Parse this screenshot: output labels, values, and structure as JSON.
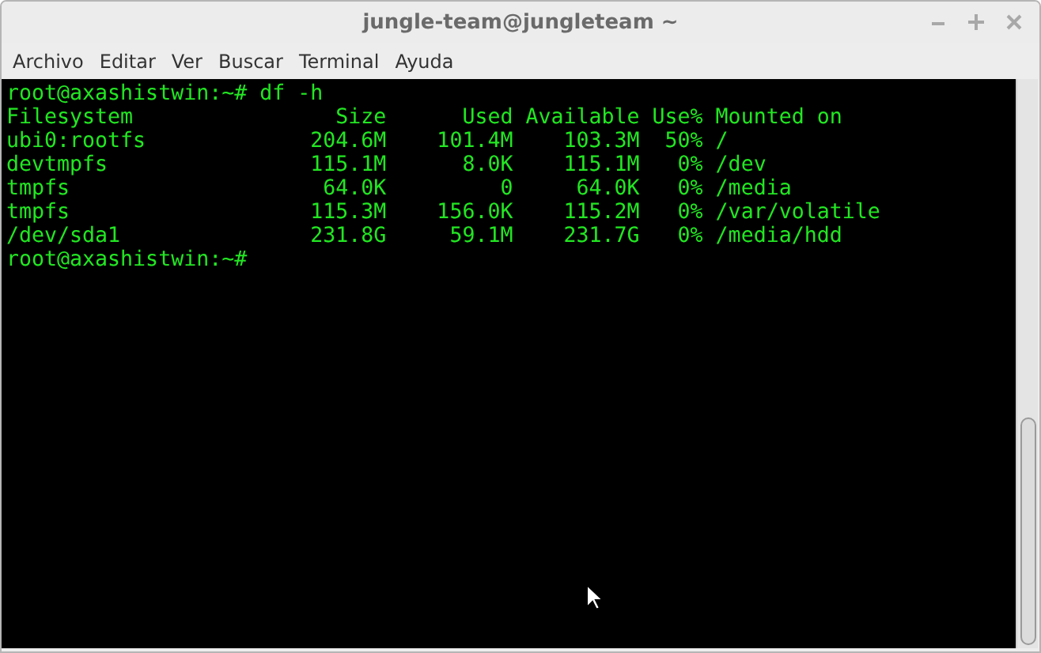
{
  "window": {
    "title": "jungle-team@jungleteam ~"
  },
  "menu": [
    "Archivo",
    "Editar",
    "Ver",
    "Buscar",
    "Terminal",
    "Ayuda"
  ],
  "terminal": {
    "lines": [
      "root@axashistwin:~# df -h",
      "Filesystem                Size      Used Available Use% Mounted on",
      "ubi0:rootfs             204.6M    101.4M    103.3M  50% /",
      "devtmpfs                115.1M      8.0K    115.1M   0% /dev",
      "tmpfs                    64.0K         0     64.0K   0% /media",
      "tmpfs                   115.3M    156.0K    115.2M   0% /var/volatile",
      "/dev/sda1               231.8G     59.1M    231.7G   0% /media/hdd",
      "root@axashistwin:~#"
    ]
  }
}
